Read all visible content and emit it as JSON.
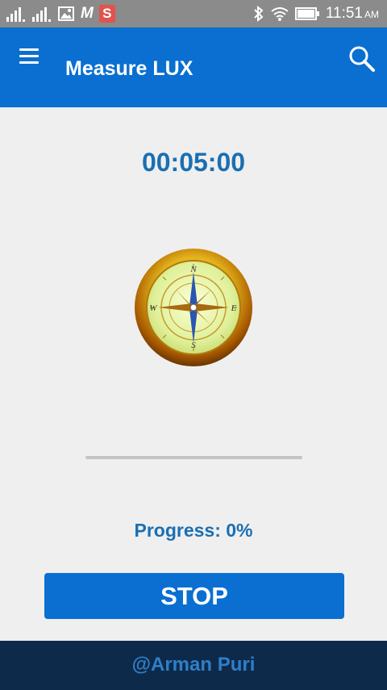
{
  "status_bar": {
    "time": "11:51",
    "ampm": "AM",
    "icons": [
      "signal-icon",
      "signal-icon",
      "image-icon",
      "m-icon",
      "s-icon",
      "bluetooth-icon",
      "wifi-icon",
      "battery-icon"
    ],
    "m_glyph": "M",
    "s_glyph": "S"
  },
  "app_bar": {
    "title": "Measure LUX",
    "background": "#0a6fd0"
  },
  "main": {
    "timer": "00:05:00",
    "progress_label": "Progress: 0%",
    "progress_fraction": 0,
    "compass_labels": {
      "n": "N",
      "e": "E",
      "s": "S",
      "w": "W"
    }
  },
  "stop_button": {
    "label": "STOP"
  },
  "footer": {
    "text": "@Arman Puri",
    "background": "#0e2a4a"
  }
}
